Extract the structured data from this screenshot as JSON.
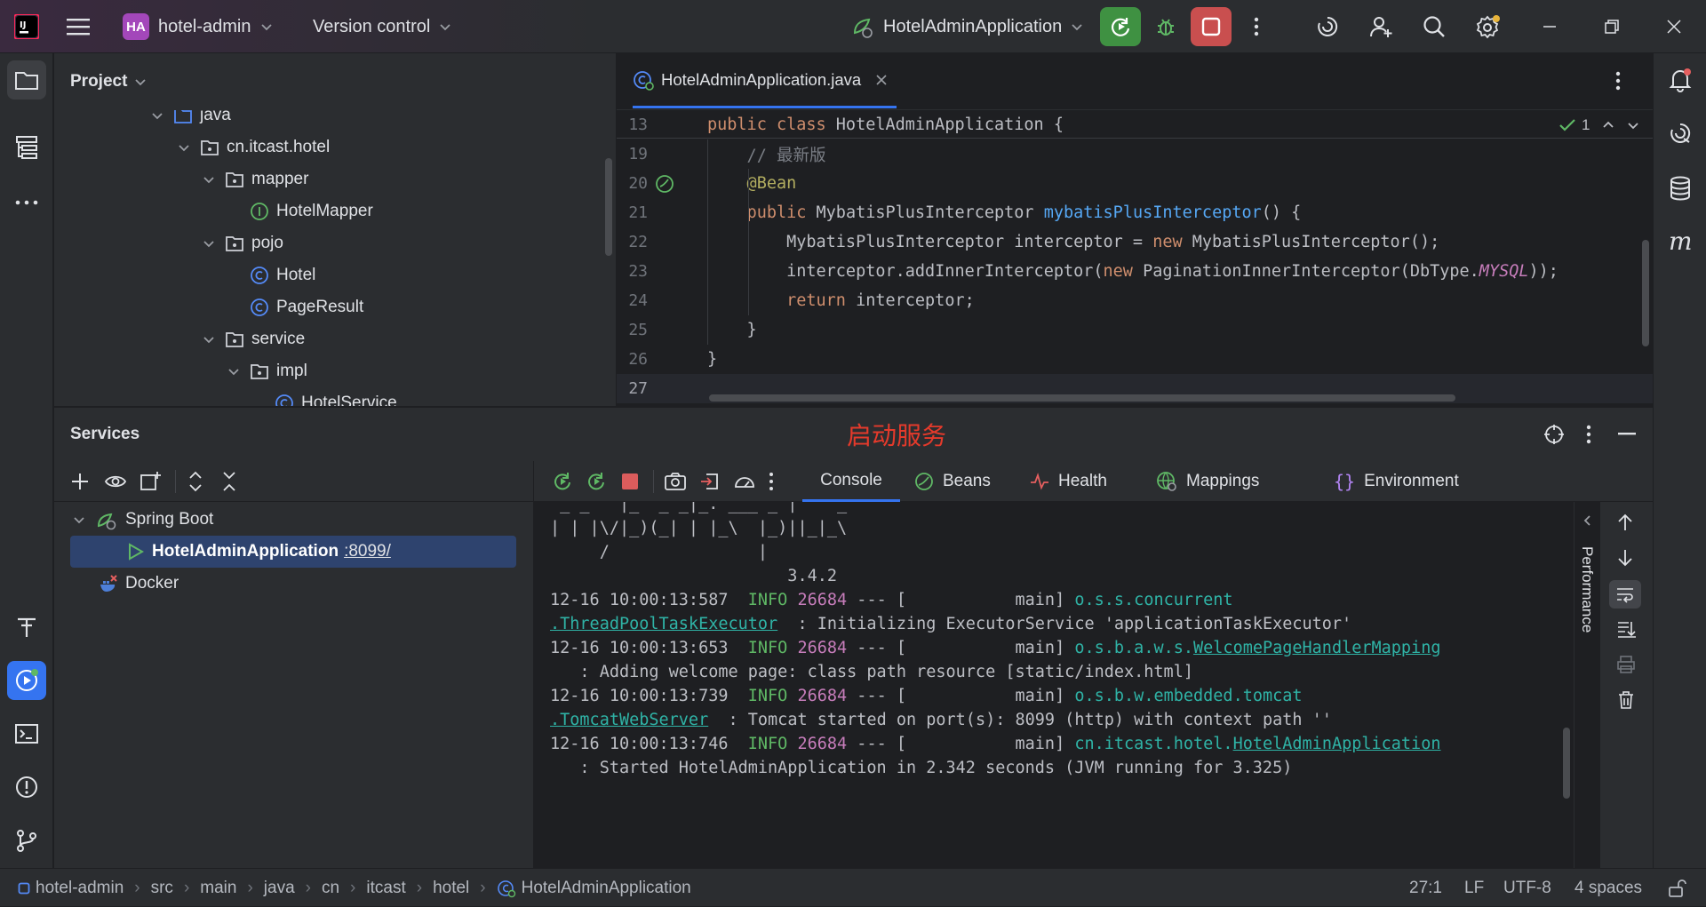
{
  "titlebar": {
    "project_badge": "HA",
    "project_name": "hotel-admin",
    "vcs_label": "Version control",
    "run_config": "HotelAdminApplication",
    "colors": {
      "run_green": "#3f9142",
      "stop_red": "#c94f4f",
      "badge": "#a347ba"
    }
  },
  "project_panel": {
    "title": "Project",
    "tree": [
      {
        "label": "java",
        "type": "folder",
        "depth": 0
      },
      {
        "label": "cn.itcast.hotel",
        "type": "package",
        "depth": 1
      },
      {
        "label": "mapper",
        "type": "package",
        "depth": 2
      },
      {
        "label": "HotelMapper",
        "type": "interface",
        "depth": 3
      },
      {
        "label": "pojo",
        "type": "package",
        "depth": 2
      },
      {
        "label": "Hotel",
        "type": "class",
        "depth": 3
      },
      {
        "label": "PageResult",
        "type": "class",
        "depth": 3
      },
      {
        "label": "service",
        "type": "package",
        "depth": 2
      },
      {
        "label": "impl",
        "type": "package",
        "depth": 3
      },
      {
        "label": "HotelService",
        "type": "class",
        "depth": 4
      }
    ]
  },
  "editor": {
    "tab_label": "HotelAdminApplication.java",
    "inspection_count": "1",
    "lines": [
      {
        "num": "13",
        "text": "public class HotelAdminApplication {"
      },
      {
        "num": "19",
        "text": "    // 最新版"
      },
      {
        "num": "20",
        "text": "    @Bean"
      },
      {
        "num": "21",
        "text": "    public MybatisPlusInterceptor mybatisPlusInterceptor() {"
      },
      {
        "num": "22",
        "text": "        MybatisPlusInterceptor interceptor = new MybatisPlusInterceptor();"
      },
      {
        "num": "23",
        "text": "        interceptor.addInnerInterceptor(new PaginationInnerInterceptor(DbType.MYSQL));"
      },
      {
        "num": "24",
        "text": "        return interceptor;"
      },
      {
        "num": "25",
        "text": "    }"
      },
      {
        "num": "26",
        "text": "}"
      },
      {
        "num": "27",
        "text": ""
      }
    ]
  },
  "services": {
    "title": "Services",
    "annotation": "启动服务",
    "tree": {
      "spring_boot": "Spring Boot",
      "app_name": "HotelAdminApplication",
      "app_port": ":8099/",
      "docker": "Docker"
    },
    "tabs": [
      "Console",
      "Beans",
      "Health",
      "Mappings",
      "Environment"
    ],
    "side_label": "Performance",
    "console": {
      "banner_1": " _ _   |_  _ _|_. ___ _ |    _",
      "banner_2": "| | |\\/|_)(_| | |_\\  |_)||_|_\\",
      "banner_3": "     /               |",
      "banner_4": "                        3.4.2",
      "log1_time": "12-16 10:00:13:587",
      "log1_level": "INFO",
      "log1_pid": "26684",
      "log1_thread": " --- [           main] ",
      "log1_logger": "o.s.s.concurrent",
      "log1_logger2": ".ThreadPoolTaskExecutor",
      "log1_msg": "  : Initializing ExecutorService 'applicationTaskExecutor'",
      "log2_time": "12-16 10:00:13:653",
      "log2_level": "INFO",
      "log2_pid": "26684",
      "log2_thread": " --- [           main] ",
      "log2_logger": "o.s.b.a.w.s.",
      "log2_logger_u": "WelcomePageHandlerMapping",
      "log2_msg": "   : Adding welcome page: class path resource [static/index.html]",
      "log3_time": "12-16 10:00:13:739",
      "log3_level": "INFO",
      "log3_pid": "26684",
      "log3_thread": " --- [           main] ",
      "log3_logger": "o.s.b.w.embedded.tomcat",
      "log3_logger2": ".TomcatWebServer",
      "log3_msg": "  : Tomcat started on port(s): 8099 (http) with context path ''",
      "log4_time": "12-16 10:00:13:746",
      "log4_level": "INFO",
      "log4_pid": "26684",
      "log4_thread": " --- [           main] ",
      "log4_logger": "cn.itcast.hotel.",
      "log4_logger_u": "HotelAdminApplication",
      "log4_msg": "   : Started HotelAdminApplication in 2.342 seconds (JVM running for 3.325)"
    }
  },
  "statusbar": {
    "breadcrumb": [
      "hotel-admin",
      "src",
      "main",
      "java",
      "cn",
      "itcast",
      "hotel",
      "HotelAdminApplication"
    ],
    "position": "27:1",
    "line_sep": "LF",
    "encoding": "UTF-8",
    "indent": "4 spaces"
  }
}
